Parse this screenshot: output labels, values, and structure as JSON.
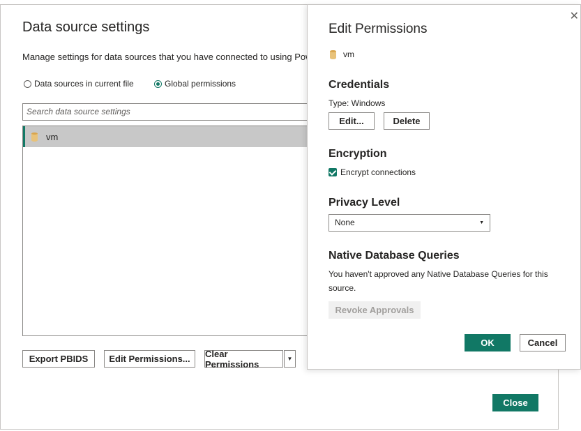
{
  "dialog": {
    "title": "Data source settings",
    "description": "Manage settings for data sources that you have connected to using Pow",
    "radio_current_file": "Data sources in current file",
    "radio_global": "Global permissions",
    "search_placeholder": "Search data source settings",
    "list_items": [
      {
        "label": "vm",
        "selected": true
      }
    ],
    "buttons": {
      "export": "Export PBIDS",
      "edit_permissions": "Edit Permissions...",
      "clear_permissions": "Clear Permissions",
      "close": "Close"
    }
  },
  "panel": {
    "title": "Edit Permissions",
    "source_name": "vm",
    "credentials": {
      "heading": "Credentials",
      "type_text": "Type: Windows",
      "edit": "Edit...",
      "delete": "Delete"
    },
    "encryption": {
      "heading": "Encryption",
      "checkbox_label": "Encrypt connections",
      "checked": true
    },
    "privacy": {
      "heading": "Privacy Level",
      "value": "None"
    },
    "native": {
      "heading": "Native Database Queries",
      "text_line1": "You haven't approved any Native Database Queries for this",
      "text_line2": "source.",
      "revoke": "Revoke Approvals"
    },
    "ok": "OK",
    "cancel": "Cancel",
    "close_glyph": "✕"
  },
  "colors": {
    "accent": "#117865",
    "selected_row": "#c8c8c8",
    "db_icon": "#e8c27a"
  }
}
